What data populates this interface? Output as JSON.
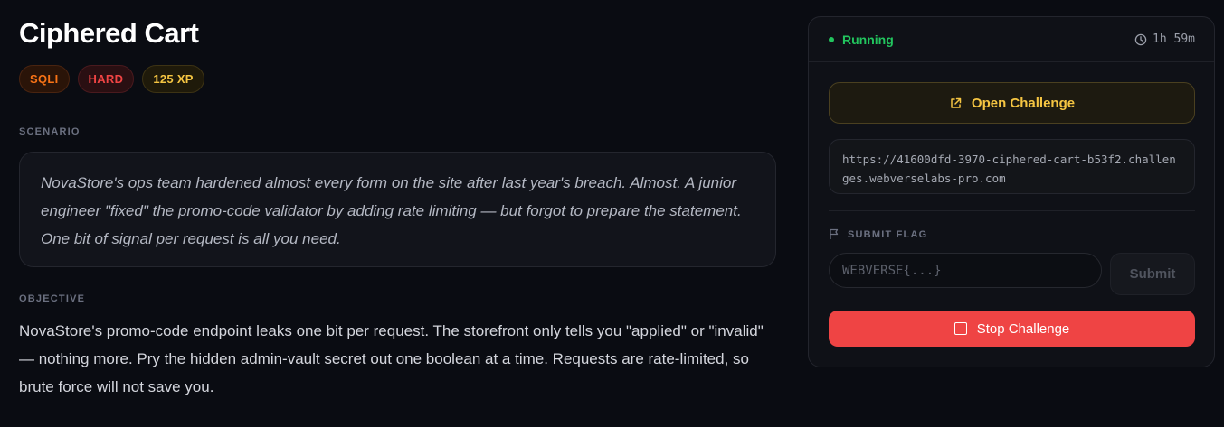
{
  "challenge": {
    "title": "Ciphered Cart",
    "badges": {
      "category": "SQLI",
      "difficulty": "HARD",
      "xp": "125 XP"
    },
    "scenario_label": "SCENARIO",
    "scenario_text": "NovaStore's ops team hardened almost every form on the site after last year's breach. Almost. A junior engineer \"fixed\" the promo-code validator by adding rate limiting — but forgot to prepare the statement. One bit of signal per request is all you need.",
    "objective_label": "OBJECTIVE",
    "objective_text": "NovaStore's promo-code endpoint leaks one bit per request. The storefront only tells you \"applied\" or \"invalid\" — nothing more. Pry the hidden admin-vault secret out one boolean at a time. Requests are rate-limited, so brute force will not save you."
  },
  "panel": {
    "status": "Running",
    "timer": "1h 59m",
    "open_button": "Open Challenge",
    "url": "https://41600dfd-3970-ciphered-cart-b53f2.challenges.webverselabs-pro.com",
    "submit_label": "SUBMIT FLAG",
    "flag_placeholder": "WEBVERSE{...}",
    "flag_value": "",
    "submit_button": "Submit",
    "stop_button": "Stop Challenge"
  },
  "colors": {
    "background": "#0a0c12",
    "status_green": "#22c55e",
    "accent_gold": "#f5c542",
    "danger_red": "#ef4444",
    "category_orange": "#f97316"
  },
  "icons": {
    "status": "status-dot-icon",
    "timer": "clock-icon",
    "open": "external-link-icon",
    "flag": "flag-icon",
    "stop": "stop-square-icon"
  }
}
